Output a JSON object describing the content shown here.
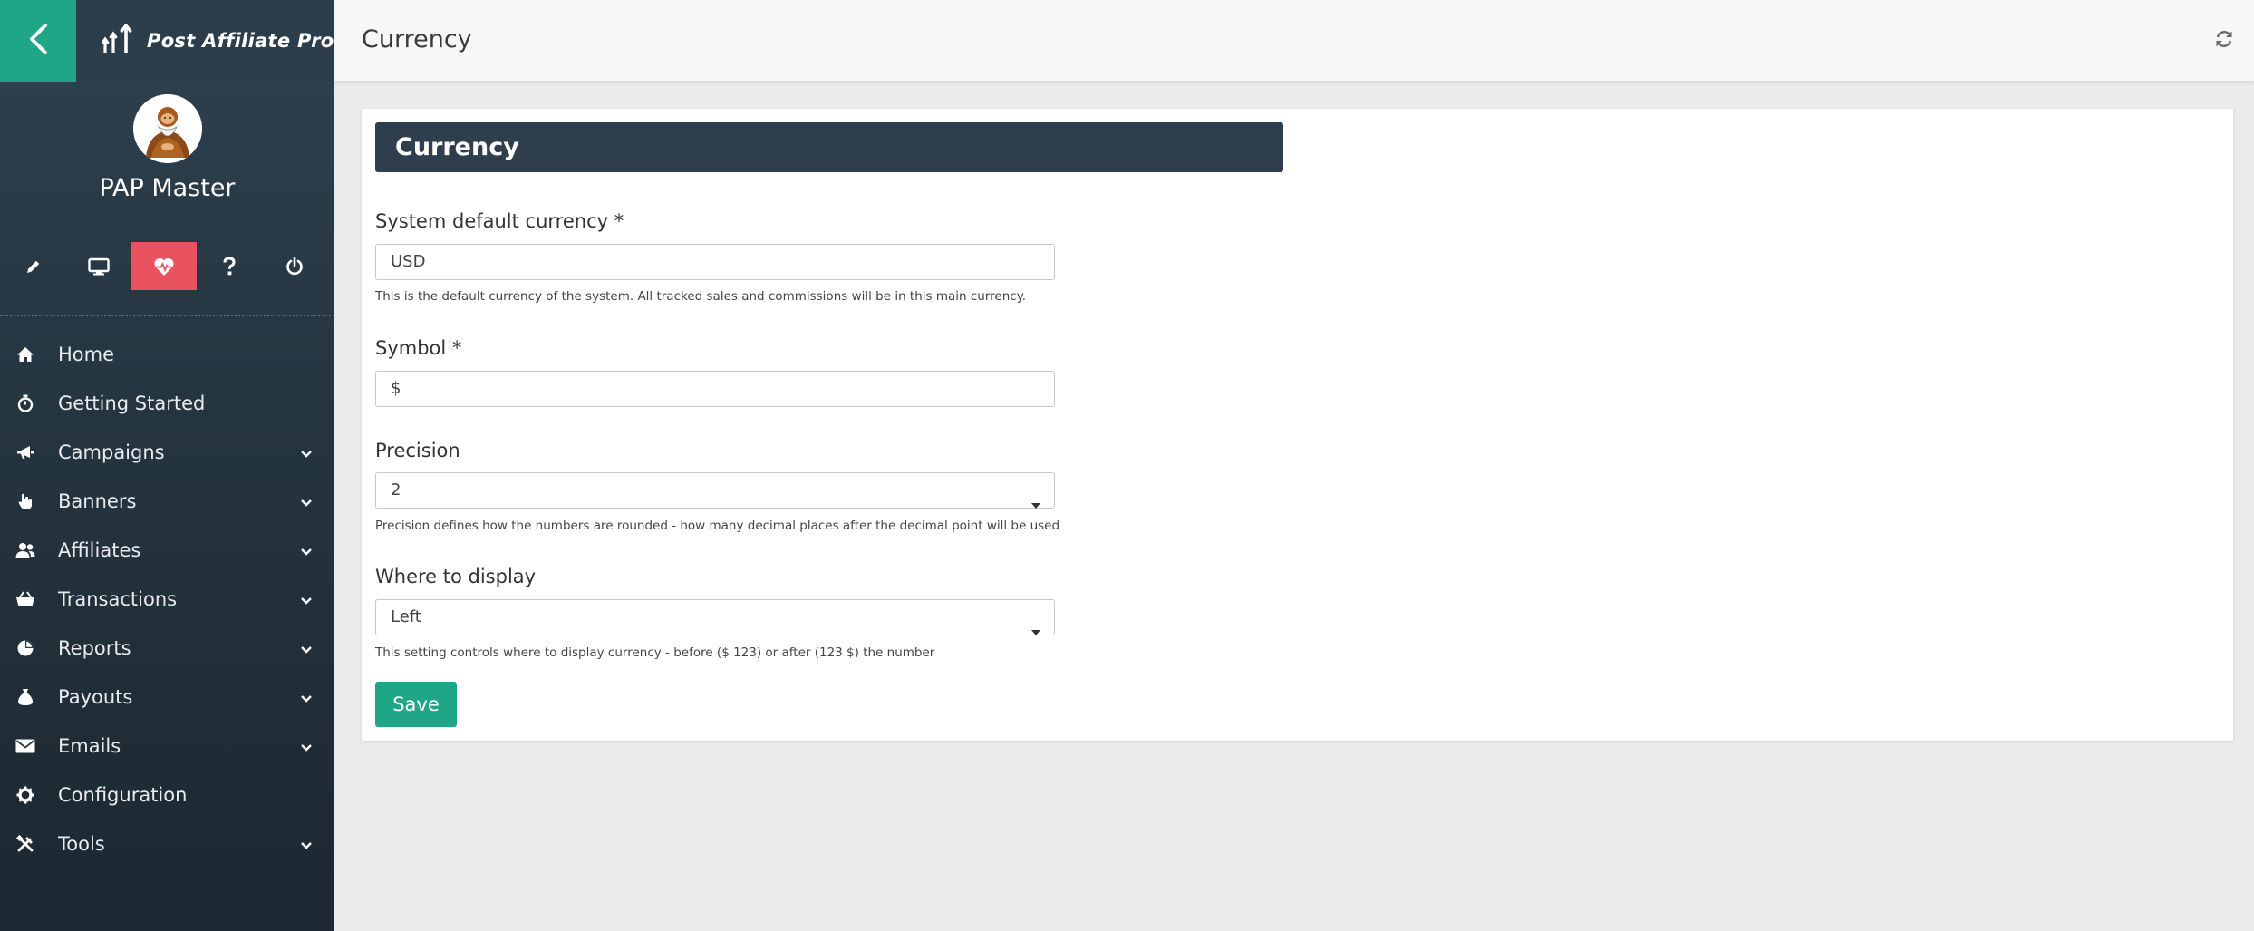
{
  "app": {
    "brand": "Post Affiliate Pro",
    "accent_color": "#1fa687",
    "active_icon_color": "#e9525f"
  },
  "sidebar": {
    "back_icon": "chevron-left-icon",
    "profile_name": "PAP Master",
    "quick_icons": [
      {
        "name": "pencil-icon"
      },
      {
        "name": "monitor-icon"
      },
      {
        "name": "heartbeat-icon",
        "active": true
      },
      {
        "name": "question-icon"
      },
      {
        "name": "power-icon"
      }
    ],
    "items": [
      {
        "label": "Home",
        "icon": "home-icon",
        "expandable": false
      },
      {
        "label": "Getting Started",
        "icon": "stopwatch-icon",
        "expandable": false
      },
      {
        "label": "Campaigns",
        "icon": "megaphone-icon",
        "expandable": true
      },
      {
        "label": "Banners",
        "icon": "pointer-hand-icon",
        "expandable": true
      },
      {
        "label": "Affiliates",
        "icon": "users-icon",
        "expandable": true
      },
      {
        "label": "Transactions",
        "icon": "basket-icon",
        "expandable": true
      },
      {
        "label": "Reports",
        "icon": "pie-chart-icon",
        "expandable": true
      },
      {
        "label": "Payouts",
        "icon": "money-bag-icon",
        "expandable": true
      },
      {
        "label": "Emails",
        "icon": "envelope-icon",
        "expandable": true
      },
      {
        "label": "Configuration",
        "icon": "gear-icon",
        "expandable": false
      },
      {
        "label": "Tools",
        "icon": "tools-icon",
        "expandable": true
      }
    ]
  },
  "header": {
    "title": "Currency",
    "refresh_icon": "refresh-icon"
  },
  "form": {
    "section_title": "Currency",
    "default_currency": {
      "label": "System default currency *",
      "value": "USD",
      "hint": "This is the default currency of the system. All tracked sales and commissions will be in this main currency."
    },
    "symbol": {
      "label": "Symbol *",
      "value": "$"
    },
    "precision": {
      "label": "Precision",
      "value": "2",
      "hint": "Precision defines how the numbers are rounded - how many decimal places after the decimal point will be used"
    },
    "where_to_display": {
      "label": "Where to display",
      "value": "Left",
      "hint": "This setting controls where to display currency - before ($ 123) or after (123 $) the number"
    },
    "save_label": "Save"
  }
}
